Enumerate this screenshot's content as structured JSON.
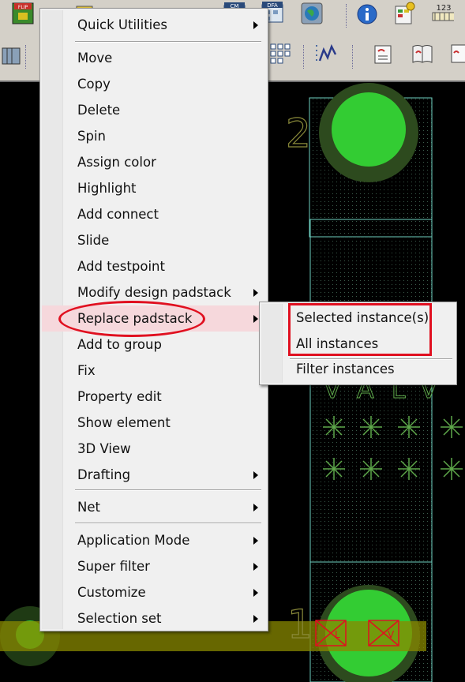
{
  "toolbar_icons": [
    "flip-icon",
    "component-icon",
    "cm-icon",
    "dfa-icon",
    "globe-icon",
    "info-icon",
    "status-icon",
    "counter-icon",
    "binder-icon",
    "grid-icon",
    "waveform-icon",
    "script-icon",
    "book-icon",
    "page-icon"
  ],
  "toolbar_labels": {
    "flip": "FLIP",
    "cm": "CM",
    "dfa": "DFA",
    "counter": "123"
  },
  "canvas": {
    "pin_top": "2",
    "pin_bottom": "1",
    "silk_text": "VALV",
    "part_labels": [
      "L",
      "V"
    ]
  },
  "context_menu": {
    "items": [
      {
        "label": "Quick Utilities",
        "submenu": true
      },
      {
        "label": "Move"
      },
      {
        "label": "Copy"
      },
      {
        "label": "Delete"
      },
      {
        "label": "Spin"
      },
      {
        "label": "Assign color"
      },
      {
        "label": "Highlight"
      },
      {
        "label": "Add connect"
      },
      {
        "label": "Slide"
      },
      {
        "label": "Add testpoint"
      },
      {
        "label": "Modify design padstack",
        "submenu": true
      },
      {
        "label": "Replace padstack",
        "submenu": true,
        "highlighted": true
      },
      {
        "label": "Add to group"
      },
      {
        "label": "Fix"
      },
      {
        "label": "Property edit"
      },
      {
        "label": "Show element"
      },
      {
        "label": "3D View"
      },
      {
        "label": "Drafting",
        "submenu": true
      },
      {
        "label": "Net",
        "submenu": true
      },
      {
        "label": "Application Mode",
        "submenu": true
      },
      {
        "label": "Super filter",
        "submenu": true
      },
      {
        "label": "Customize",
        "submenu": true
      },
      {
        "label": "Selection set",
        "submenu": true
      }
    ]
  },
  "submenu": {
    "items": [
      "Selected instance(s)",
      "All instances",
      "Filter instances"
    ]
  },
  "colors": {
    "annotation": "#e01020",
    "pad_fill": "#33cc33",
    "pad_ring": "#2d4a1e",
    "outline": "#7fd8c8",
    "trace": "#8a8a00",
    "hover": "#f6d8dc"
  }
}
